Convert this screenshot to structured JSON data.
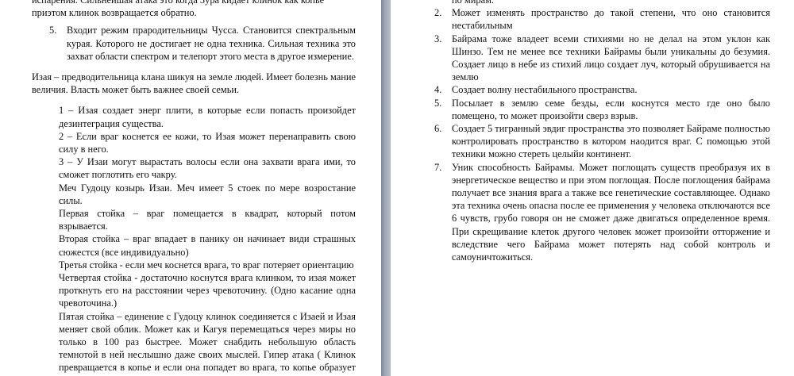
{
  "left_page": {
    "top_line": "испарения. Сильнейшая атака это когда Зура кидает клинок как копье",
    "top_line2": "приэтом клинок возвращается обратно.",
    "item5_num": "5.",
    "item5_text": "Входит режим прародительницы Чусса. Становится спектральным курая. Которого не достигает не одна техника. Сильная техника это захват области спектром и телепорт этого места в другое измерение.",
    "izaya_intro": "Изая – предводительница клана шикуя на земле людей. Имеет болезнь мание величия. Власть может быть важнее своей семьи.",
    "izaya_points": [
      "1 – Изая создает энерг плити, в которые если попасть произойдет дезинтеграция существа.",
      "2 – Если враг коснется ее кожи, то Изая может перенаправить свою силу в него.",
      "3 – У Изаи могут вырастать волосы если она захвати врага ими, то сможет поглотить его чакру."
    ],
    "sword_paras": [
      "Меч Гудоцу козырь Изаи. Меч имеет 5 стоек по мере возростание силы.",
      "Первая стойка – враг помещается в квадрат, который потом взрывается.",
      "Вторая стойка – враг впадает в панику он начинает види страшных сюжестся (все индивидуально)",
      "Третья стойка - если меч коснется врага, то враг потеряет ориентацию",
      "Четвертая стойка - достаточно коснутся врага клинком, то изая может проткнуть его на расстоянии через чревоточину. (Одно касание одна чревоточина.)",
      "Пятая стойка – единение с Гудоцу клинок соединяется с Изаей и Изая меняет свой облик. Может как и Кагуя перемещаться через миры но только в 100 раз быстрее. Может снабдить небольшую область темнотой в ней неслышно даже своих мыслей. Гипер атака ( Клинок превращается в копье и если она попадет во врага, то копье образует черную дыру и поглотит все на своем пути."
    ]
  },
  "right_page": {
    "top_line": "по мирам.",
    "items": [
      {
        "num": "2.",
        "text": "Может изменять пространство до такой степени, что оно становится нестабильным"
      },
      {
        "num": "3.",
        "text": "Байрама тоже владеет всеми стихиями но не делал на этом уклон как Шинзо. Тем не менее все техники Байрамы были уникальны до безумия. Создает лицо в небе из стихий лицо создает луч, который обрушивается на землю"
      },
      {
        "num": "4.",
        "text": "Создает волну нестабильного пространства."
      },
      {
        "num": "5.",
        "text": "Посылает в землю семе безды, если коснутся место где оно было помещено, то может произойти сверз взрыв."
      },
      {
        "num": "6.",
        "text": "Создает 5 тигранный эвдиг пространства это позволяет Байраме полностью контролировать пространство в котором наодится враг. С помощью этой техники можно стереть целыйи континент."
      },
      {
        "num": "7.",
        "text": "Уник способность Байрамы. Может поглощать существ преобразуя их в энергетическое вещество и при этом поглощая. После поглощения байрама получает все знания врага а также все генетические составляющее. Однако эта техника очень опасна после ее применения у человека отключаются все 6 чувств, грубо говоря он не сможет даже двигаться определенное время. При скрещивание клеток другого человек может произойти отторжение и вследствие чего Байрама может потерять над собой контроль и самоуничтожиться."
      }
    ]
  }
}
